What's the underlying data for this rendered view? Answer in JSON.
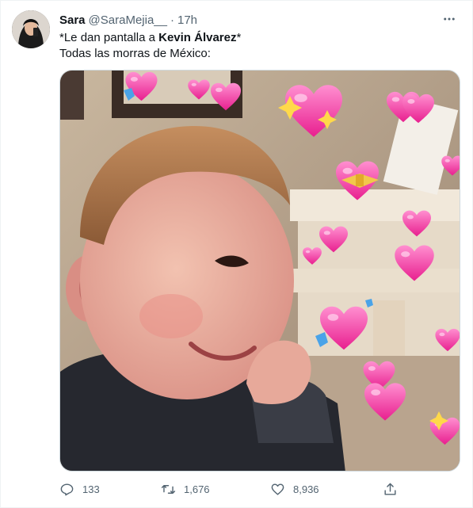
{
  "tweet": {
    "author_name": "Sara",
    "handle": "@SaraMejia__",
    "separator": "·",
    "time": "17h",
    "line1_prefix": "*Le dan pantalla a ",
    "line1_bold": "Kevin Álvarez",
    "line1_suffix": "*",
    "line2": "Todas las morras de México:"
  },
  "actions": {
    "replies": "133",
    "retweets": "1,676",
    "likes": "8,936"
  },
  "icons": {
    "more": "more-horizontal-icon",
    "reply": "reply-icon",
    "retweet": "retweet-icon",
    "like": "heart-icon",
    "share": "share-icon"
  },
  "colors": {
    "secondary_text": "#536471",
    "heart_pink": "#ff3fa4"
  }
}
